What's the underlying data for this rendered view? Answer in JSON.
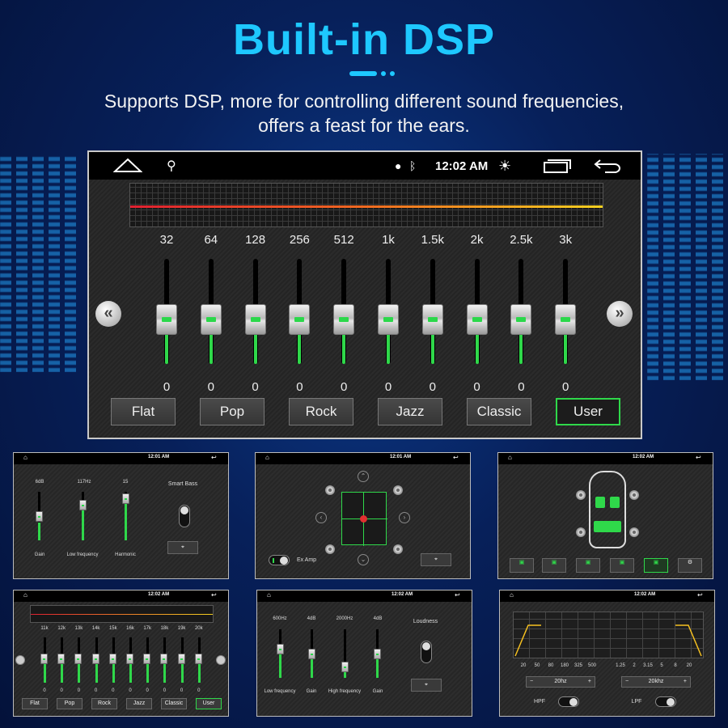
{
  "header": {
    "title": "Built-in DSP",
    "subtitle_line1": "Supports DSP, more for controlling different sound frequencies,",
    "subtitle_line2": "offers a feast for the ears."
  },
  "main_screen": {
    "status": {
      "time": "12:02 AM"
    },
    "equalizer": {
      "bands": [
        {
          "freq": "32",
          "value": "0"
        },
        {
          "freq": "64",
          "value": "0"
        },
        {
          "freq": "128",
          "value": "0"
        },
        {
          "freq": "256",
          "value": "0"
        },
        {
          "freq": "512",
          "value": "0"
        },
        {
          "freq": "1k",
          "value": "0"
        },
        {
          "freq": "1.5k",
          "value": "0"
        },
        {
          "freq": "2k",
          "value": "0"
        },
        {
          "freq": "2.5k",
          "value": "0"
        },
        {
          "freq": "3k",
          "value": "0"
        }
      ],
      "slider_level": 0.5
    },
    "presets": [
      "Flat",
      "Pop",
      "Rock",
      "Jazz",
      "Classic",
      "User"
    ],
    "active_preset": "User",
    "accent_color": "#2fd84a"
  },
  "thumb_bass": {
    "time": "12:01 AM",
    "top_values": [
      "6dB",
      "117Hz",
      "15"
    ],
    "labels": [
      "Gain",
      "Low frequency",
      "Harmonic"
    ],
    "title": "Smart Bass"
  },
  "thumb_speaker": {
    "time": "12:01 AM",
    "ex_amp_label": "Ex Amp"
  },
  "thumb_car": {
    "time": "12:02 AM"
  },
  "thumb_eq2": {
    "time": "12:02 AM",
    "freqs": [
      "11k",
      "12k",
      "13k",
      "14k",
      "15k",
      "16k",
      "17k",
      "18k",
      "19k",
      "20k"
    ],
    "values": [
      "0",
      "0",
      "0",
      "0",
      "0",
      "0",
      "0",
      "0",
      "0",
      "0"
    ],
    "presets": [
      "Flat",
      "Pop",
      "Rock",
      "Jazz",
      "Classic",
      "User"
    ]
  },
  "thumb_loud": {
    "time": "12:02 AM",
    "top_values": [
      "600Hz",
      "4dB",
      "2000Hz",
      "4dB"
    ],
    "labels": [
      "Low frequency",
      "Gain",
      "High frequency",
      "Gain"
    ],
    "title": "Loudness"
  },
  "thumb_filter": {
    "time": "12:02 AM",
    "x_left": [
      "20",
      "50",
      "80",
      "180",
      "325",
      "500"
    ],
    "x_right": [
      "1.25",
      "2",
      "3.15",
      "5",
      "8",
      "20"
    ],
    "hpf_value": "20hz",
    "lpf_value": "20khz",
    "hpf_label": "HPF",
    "lpf_label": "LPF"
  }
}
